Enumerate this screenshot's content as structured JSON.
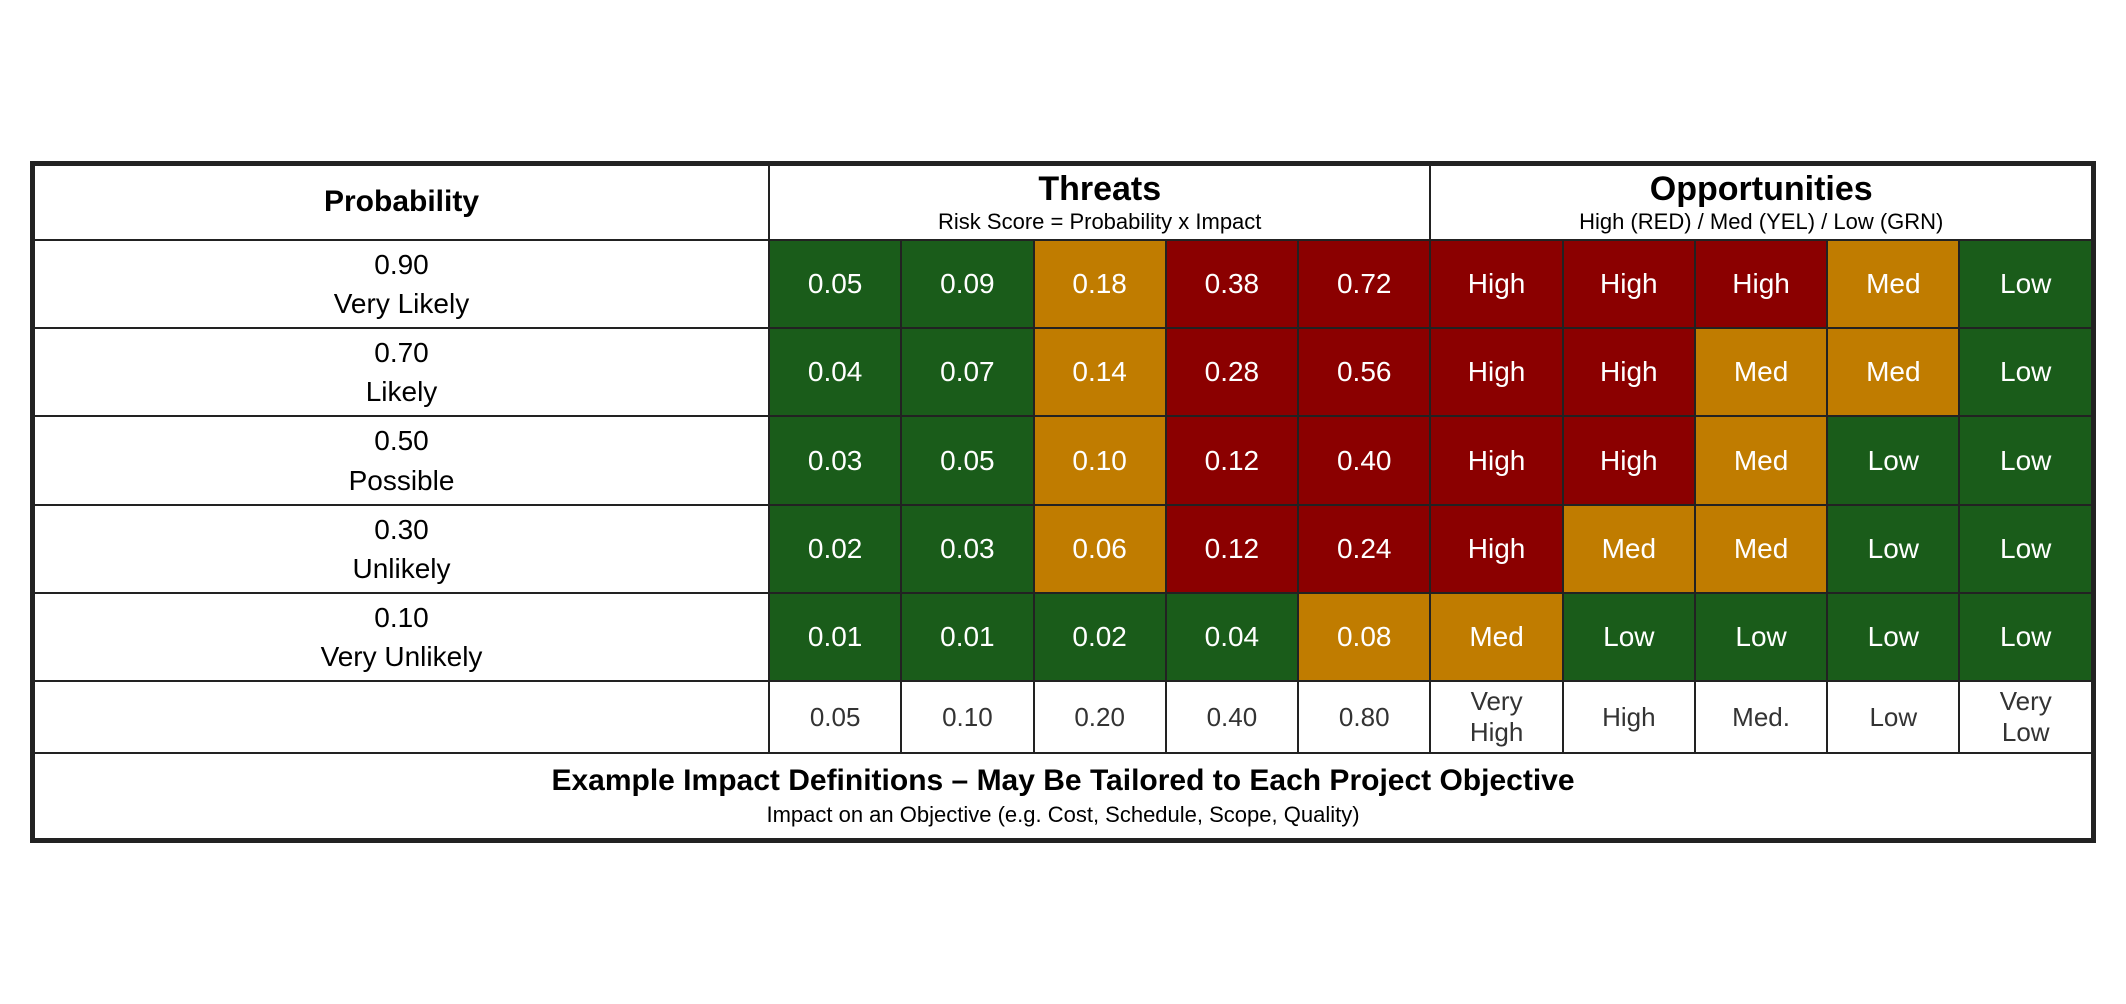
{
  "header": {
    "probability_label": "Probability",
    "threats_title": "Threats",
    "threats_subtitle": "Risk Score = Probability x Impact",
    "opps_title": "Opportunities",
    "opps_subtitle": "High (RED) / Med (YEL)  / Low (GRN)"
  },
  "rows": [
    {
      "prob_top": "0.90",
      "prob_bottom": "Very Likely",
      "threats": [
        "0.05",
        "0.09",
        "0.18",
        "0.38",
        "0.72"
      ],
      "threat_colors": [
        "dark-green",
        "dark-green",
        "dark-amber",
        "dark-red",
        "dark-red"
      ],
      "opps": [
        "High",
        "High",
        "High",
        "Med",
        "Low"
      ],
      "opp_colors": [
        "opp-red",
        "opp-red",
        "opp-red",
        "opp-yellow",
        "opp-green"
      ]
    },
    {
      "prob_top": "0.70",
      "prob_bottom": "Likely",
      "threats": [
        "0.04",
        "0.07",
        "0.14",
        "0.28",
        "0.56"
      ],
      "threat_colors": [
        "dark-green",
        "dark-green",
        "dark-amber",
        "dark-red",
        "dark-red"
      ],
      "opps": [
        "High",
        "High",
        "Med",
        "Med",
        "Low"
      ],
      "opp_colors": [
        "opp-red",
        "opp-red",
        "opp-yellow",
        "opp-yellow",
        "opp-green"
      ]
    },
    {
      "prob_top": "0.50",
      "prob_bottom": "Possible",
      "threats": [
        "0.03",
        "0.05",
        "0.10",
        "0.12",
        "0.40"
      ],
      "threat_colors": [
        "dark-green",
        "dark-green",
        "dark-amber",
        "dark-red",
        "dark-red"
      ],
      "opps": [
        "High",
        "High",
        "Med",
        "Low",
        "Low"
      ],
      "opp_colors": [
        "opp-red",
        "opp-red",
        "opp-yellow",
        "opp-green",
        "opp-green"
      ]
    },
    {
      "prob_top": "0.30",
      "prob_bottom": "Unlikely",
      "threats": [
        "0.02",
        "0.03",
        "0.06",
        "0.12",
        "0.24"
      ],
      "threat_colors": [
        "dark-green",
        "dark-green",
        "dark-amber",
        "dark-red",
        "dark-red"
      ],
      "opps": [
        "High",
        "Med",
        "Med",
        "Low",
        "Low"
      ],
      "opp_colors": [
        "opp-red",
        "opp-yellow",
        "opp-yellow",
        "opp-green",
        "opp-green"
      ]
    },
    {
      "prob_top": "0.10",
      "prob_bottom": "Very Unlikely",
      "threats": [
        "0.01",
        "0.01",
        "0.02",
        "0.04",
        "0.08"
      ],
      "threat_colors": [
        "dark-green",
        "dark-green",
        "dark-green",
        "dark-green",
        "dark-amber"
      ],
      "opps": [
        "Med",
        "Low",
        "Low",
        "Low",
        "Low"
      ],
      "opp_colors": [
        "opp-yellow",
        "opp-green",
        "opp-green",
        "opp-green",
        "opp-green"
      ]
    }
  ],
  "footer_impact": {
    "threats": [
      "0.05",
      "0.10",
      "0.20",
      "0.40",
      "0.80"
    ],
    "opps": [
      "Very\nHigh",
      "High",
      "Med.",
      "Low",
      "Very\nLow"
    ]
  },
  "footer_note": "Example Impact Definitions – May Be Tailored to Each Project Objective",
  "footer_note_sub": "Impact on an Objective (e.g. Cost, Schedule, Scope, Quality)"
}
